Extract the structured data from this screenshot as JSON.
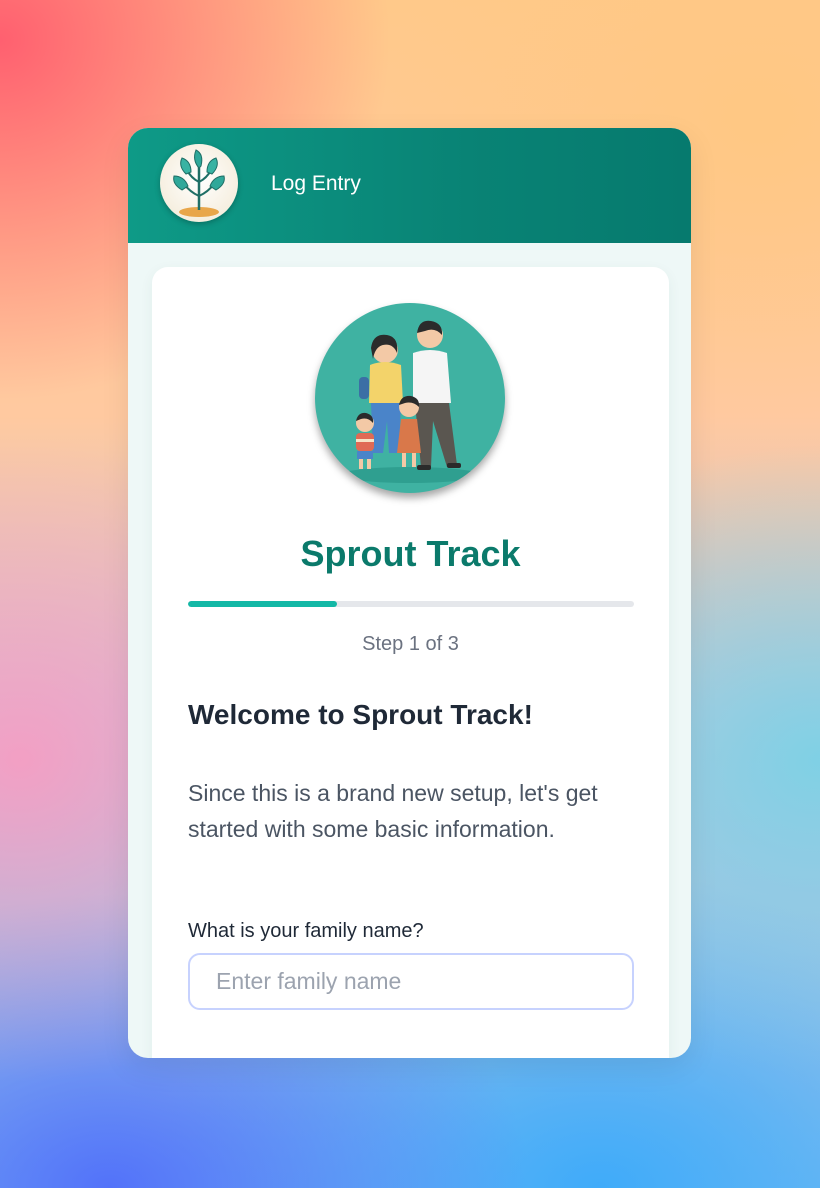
{
  "header": {
    "title": "Log Entry",
    "logo_icon": "sprout-plant-icon"
  },
  "setup": {
    "hero_icon": "family-illustration",
    "app_title": "Sprout Track",
    "progress_fraction": 0.333,
    "step_text": "Step 1 of 3",
    "heading": "Welcome to Sprout Track!",
    "description": "Since this is a brand new setup, let's get started with some basic information.",
    "family_name": {
      "label": "What is your family name?",
      "value": "",
      "placeholder": "Enter family name"
    }
  },
  "colors": {
    "accent": "#0b7a6b",
    "header": "#098375",
    "progress": "#14b8a6",
    "input_border": "#c7d2fe"
  }
}
